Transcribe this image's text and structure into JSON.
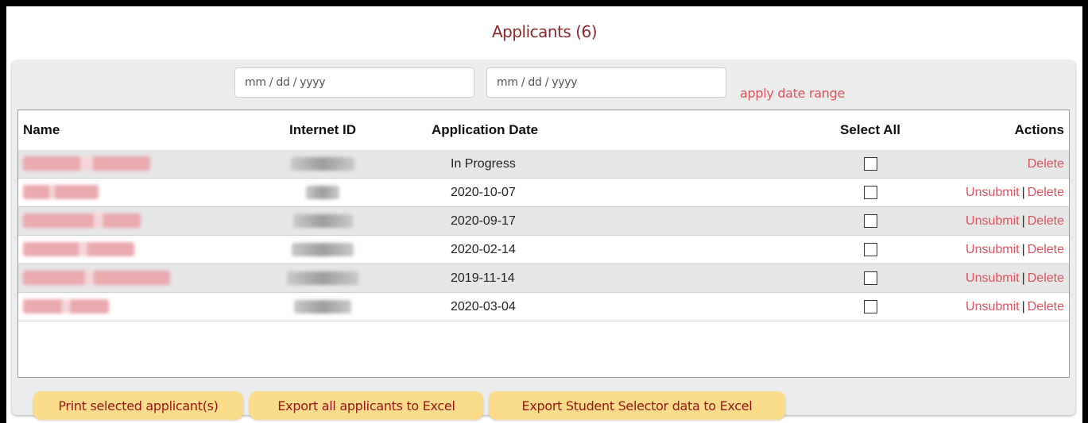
{
  "title": "Applicants (6)",
  "date_range": {
    "start_placeholder": "mm / dd / yyyy",
    "end_placeholder": "mm / dd / yyyy",
    "apply_label": "apply date range"
  },
  "table": {
    "headers": {
      "name": "Name",
      "internet_id": "Internet ID",
      "application_date": "Application Date",
      "select_all": "Select All",
      "actions": "Actions"
    },
    "rows": [
      {
        "date": "In Progress",
        "unsubmit": "",
        "delete": "Delete"
      },
      {
        "date": "2020-10-07",
        "unsubmit": "Unsubmit",
        "delete": "Delete"
      },
      {
        "date": "2020-09-17",
        "unsubmit": "Unsubmit",
        "delete": "Delete"
      },
      {
        "date": "2020-02-14",
        "unsubmit": "Unsubmit",
        "delete": "Delete"
      },
      {
        "date": "2019-11-14",
        "unsubmit": "Unsubmit",
        "delete": "Delete"
      },
      {
        "date": "2020-03-04",
        "unsubmit": "Unsubmit",
        "delete": "Delete"
      }
    ]
  },
  "buttons": {
    "print": "Print selected applicant(s)",
    "export_all": "Export all applicants to Excel",
    "export_selector": "Export Student Selector data to Excel"
  },
  "colors": {
    "title": "#8b2a2a",
    "link": "#e0525e",
    "button_bg": "#fbdc8b",
    "button_text": "#9a1515"
  }
}
